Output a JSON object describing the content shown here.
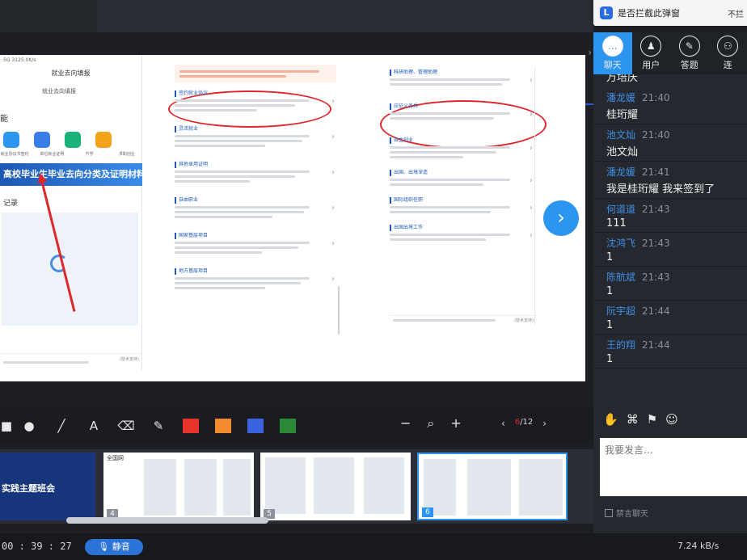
{
  "popup": {
    "logo": "L",
    "text": "是否拦截此弹窗",
    "action": "不拦"
  },
  "slide": {
    "phone": {
      "status": "5G 3125.0K/s",
      "title": "就业去向填报",
      "subtitle": "就业去向填报",
      "section": "能",
      "icon_labels": [
        "就业协议书签约",
        "单位就业证明",
        "升学",
        "求职创业"
      ],
      "icon_colors": [
        "#2b95f0",
        "#3a7ee8",
        "#19b37a",
        "#f3a21a"
      ],
      "banner": "高校毕业生毕业去向分类及证明材料",
      "records": "记录",
      "footer": "(技术支持)"
    },
    "mid_sections": [
      "签约就业协议",
      "灵活就业",
      "其他录用证明",
      "自由职业",
      "国家基层项目",
      "地方基层项目"
    ],
    "right_sections": [
      "科研助理、管理助理",
      "应征义务兵",
      "自主创业",
      "出国、出境深造",
      "国际组织任职",
      "出国出境工作"
    ],
    "right_footer": "(技术支持)"
  },
  "toolbar": {
    "tools": [
      "■",
      "●",
      "╱",
      "A",
      "⌫",
      "✎"
    ],
    "tool_names": [
      "rectangle-tool",
      "circle-tool",
      "line-tool",
      "text-tool",
      "eraser-tool",
      "highlighter-tool"
    ],
    "colors": [
      "#e8342a",
      "#f28a2e",
      "#3a63e0",
      "#2a8a3a"
    ],
    "zoom_out": "−",
    "zoom_icon": "⌕",
    "zoom_in": "+",
    "page_prev": "‹",
    "page_next": "›",
    "page_current": "6",
    "page_total": "/12"
  },
  "thumbnails": [
    {
      "num": "",
      "title": "实践主题班会"
    },
    {
      "num": "4",
      "title": "全国网"
    },
    {
      "num": "5",
      "title": ""
    },
    {
      "num": "6",
      "title": ""
    }
  ],
  "status": {
    "timer": "00 : 39 : 27",
    "mute": "静音",
    "speed": "7.24 kB/s"
  },
  "panel": {
    "tabs": [
      {
        "label": "聊天",
        "icon": "chat-icon",
        "glyph": "…"
      },
      {
        "label": "用户",
        "icon": "users-icon",
        "glyph": "♟"
      },
      {
        "label": "答题",
        "icon": "quiz-icon",
        "glyph": "✎"
      },
      {
        "label": "连",
        "icon": "link-icon",
        "glyph": "⚇"
      }
    ],
    "partial_message": "万培庆",
    "messages": [
      {
        "name": "潘龙媛",
        "time": "21:40",
        "text": "桂珩耀"
      },
      {
        "name": "池文灿",
        "time": "21:40",
        "text": "池文灿"
      },
      {
        "name": "潘龙媛",
        "time": "21:41",
        "text": "我是桂珩耀 我来签到了"
      },
      {
        "name": "何道道",
        "time": "21:43",
        "text": "111"
      },
      {
        "name": "沈鸿飞",
        "time": "21:43",
        "text": "1"
      },
      {
        "name": "陈航斌",
        "time": "21:43",
        "text": "1"
      },
      {
        "name": "阮宇超",
        "time": "21:44",
        "text": "1"
      },
      {
        "name": "王的翔",
        "time": "21:44",
        "text": "1"
      }
    ],
    "chat_tools": [
      "✋",
      "⌘",
      "⚑",
      "☺"
    ],
    "input_placeholder": "我要发言...",
    "ban_label": "禁言聊天"
  }
}
